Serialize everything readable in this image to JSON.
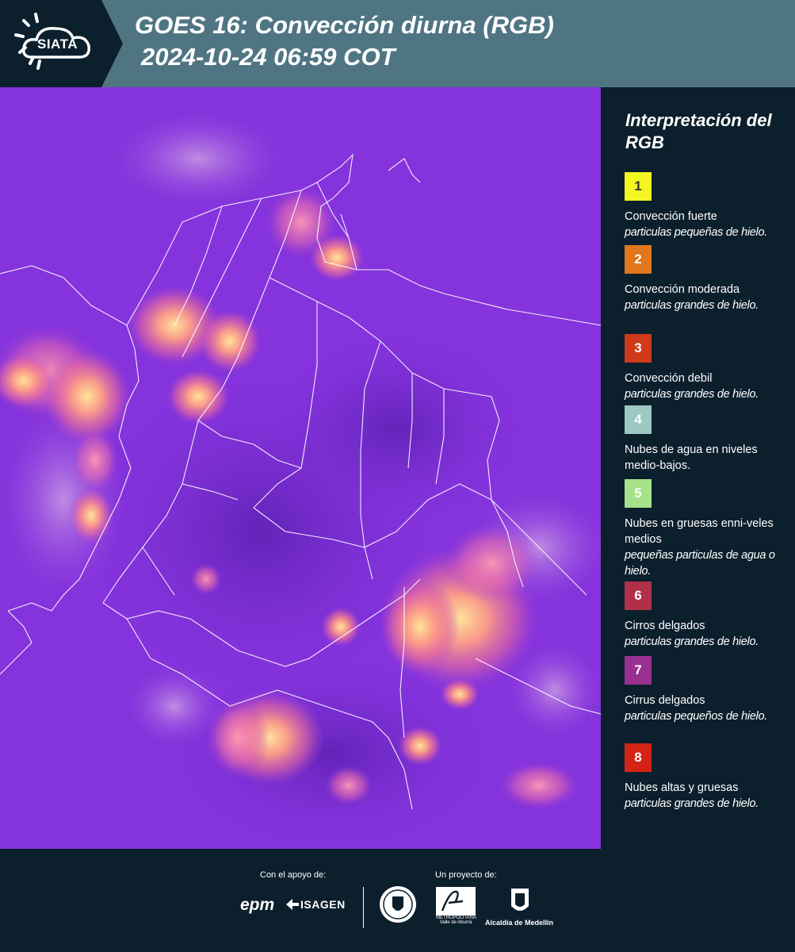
{
  "header": {
    "logo_text": "SIATA",
    "title_line1": "GOES 16: Convección diurna (RGB)",
    "title_line2": "2024-10-24 06:59 COT",
    "colors": {
      "header_bg": "#4f7583",
      "logo_bg": "#0c1f2c"
    }
  },
  "legend": {
    "title": "Interpretación del RGB",
    "items": [
      {
        "number": "1",
        "color": "#f3f620",
        "text_color": "#333333",
        "label": "Convección fuerte",
        "sub": "particulas pequeñas de hielo."
      },
      {
        "number": "2",
        "color": "#e2761c",
        "text_color": "#ffffff",
        "label": "Convección moderada",
        "sub": "particulas grandes de hielo."
      },
      {
        "number": "3",
        "color": "#cf3a1a",
        "text_color": "#ffffff",
        "label": "Convección debil",
        "sub": "particulas grandes de hielo."
      },
      {
        "number": "4",
        "color": "#9cc8c4",
        "text_color": "#ffffff",
        "label": "Nubes de agua en niveles medio-bajos.",
        "sub": ""
      },
      {
        "number": "5",
        "color": "#a6e289",
        "text_color": "#ffffff",
        "label": "Nubes en gruesas enni-veles medios",
        "sub": "pequeñas particulas de agua o hielo."
      },
      {
        "number": "6",
        "color": "#b0304a",
        "text_color": "#ffffff",
        "label": "Cirros delgados",
        "sub": "particulas grandes de hielo."
      },
      {
        "number": "7",
        "color": "#9a2f92",
        "text_color": "#ffffff",
        "label": "Cirrus delgados",
        "sub": "particulas pequeños de hielo."
      },
      {
        "number": "8",
        "color": "#d42416",
        "text_color": "#ffffff",
        "label": "Nubes altas y gruesas",
        "sub": "particulas grandes de hielo."
      }
    ]
  },
  "footer": {
    "support_label": "Con el apoyo de:",
    "project_label": "Un proyecto de:",
    "sponsors": [
      "epm",
      "ISAGEN"
    ],
    "area_logo_text": "METROPOLITANA Valle de Aburrá",
    "medellin_text": "Alcaldía de Medellín"
  }
}
